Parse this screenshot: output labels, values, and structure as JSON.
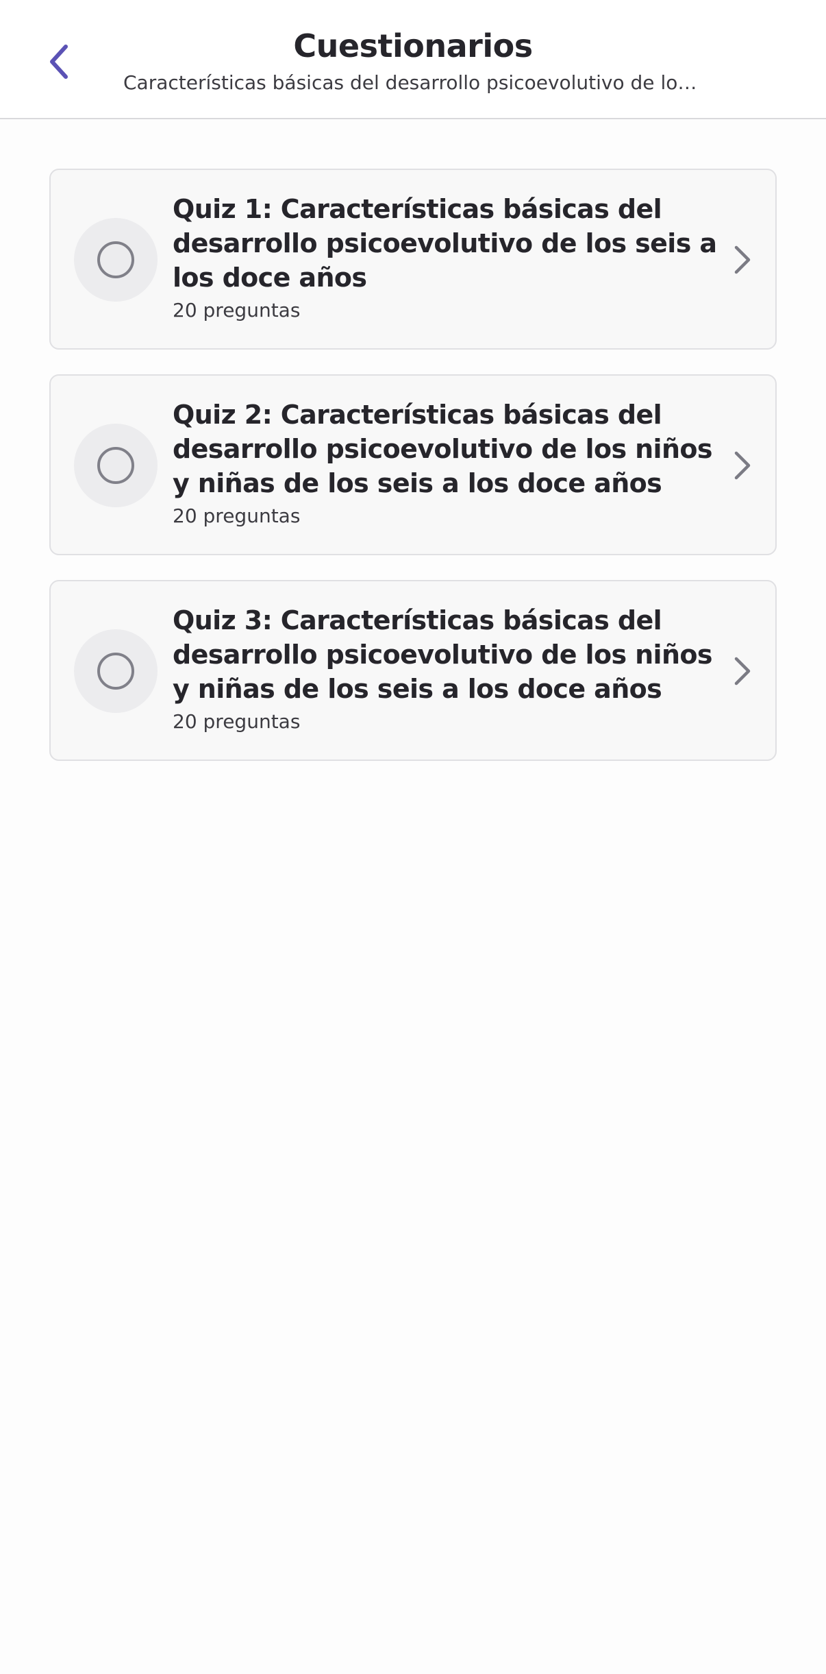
{
  "header": {
    "title": "Cuestionarios",
    "subtitle": "Características básicas del desarrollo psicoevolutivo de los...",
    "back_icon": "chevron-left-icon",
    "accent_color": "#5b52b5"
  },
  "quizzes": [
    {
      "title": "Quiz 1: Características básicas del desarrollo psicoevolutivo de los seis a los doce años",
      "meta": "20 preguntas",
      "status_icon": "empty-circle-icon",
      "chevron_icon": "chevron-right-icon"
    },
    {
      "title": "Quiz 2: Características básicas del desarrollo psicoevolutivo de los niños y niñas de los seis a los doce años",
      "meta": "20 preguntas",
      "status_icon": "empty-circle-icon",
      "chevron_icon": "chevron-right-icon"
    },
    {
      "title": "Quiz 3: Características básicas del desarrollo psicoevolutivo de los niños y niñas de los seis a los doce años",
      "meta": "20 preguntas",
      "status_icon": "empty-circle-icon",
      "chevron_icon": "chevron-right-icon"
    }
  ]
}
